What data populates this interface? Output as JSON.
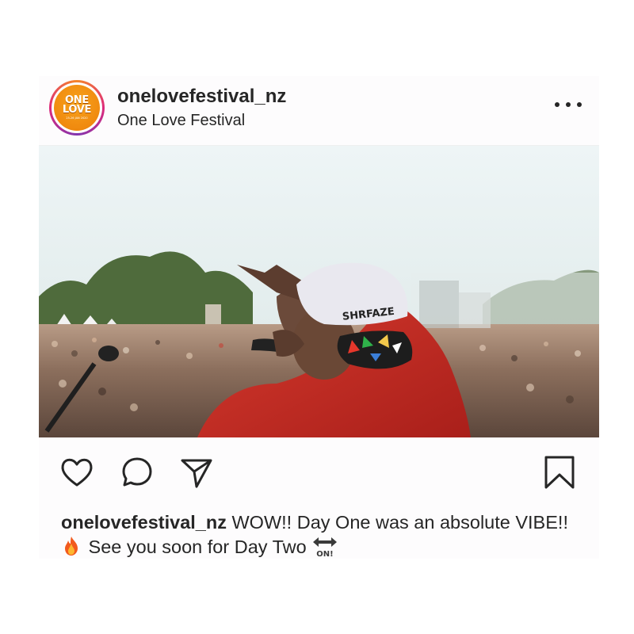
{
  "post": {
    "username": "onelovefestival_nz",
    "location": "One Love Festival",
    "avatar": {
      "line1": "ONE",
      "line2": "LOVE",
      "subline": "25-26 JAN 2020",
      "colors": {
        "ring_start": "#f58529",
        "ring_mid": "#dd2a7b",
        "logo_bg": "#f08a0f"
      }
    },
    "media": {
      "cap_text": "SHRFAZE",
      "mute_icon": "speaker-muted-icon"
    },
    "actions": {
      "like_icon": "heart-icon",
      "comment_icon": "comment-icon",
      "share_icon": "paper-plane-icon",
      "save_icon": "bookmark-icon"
    },
    "caption": {
      "username": "onelovefestival_nz",
      "text_part1": " WOW!! Day One was an absolute VIBE!!",
      "emoji1": "fire-emoji",
      "text_part2": " See you soon for Day Two",
      "emoji2_label": "ON!"
    }
  }
}
